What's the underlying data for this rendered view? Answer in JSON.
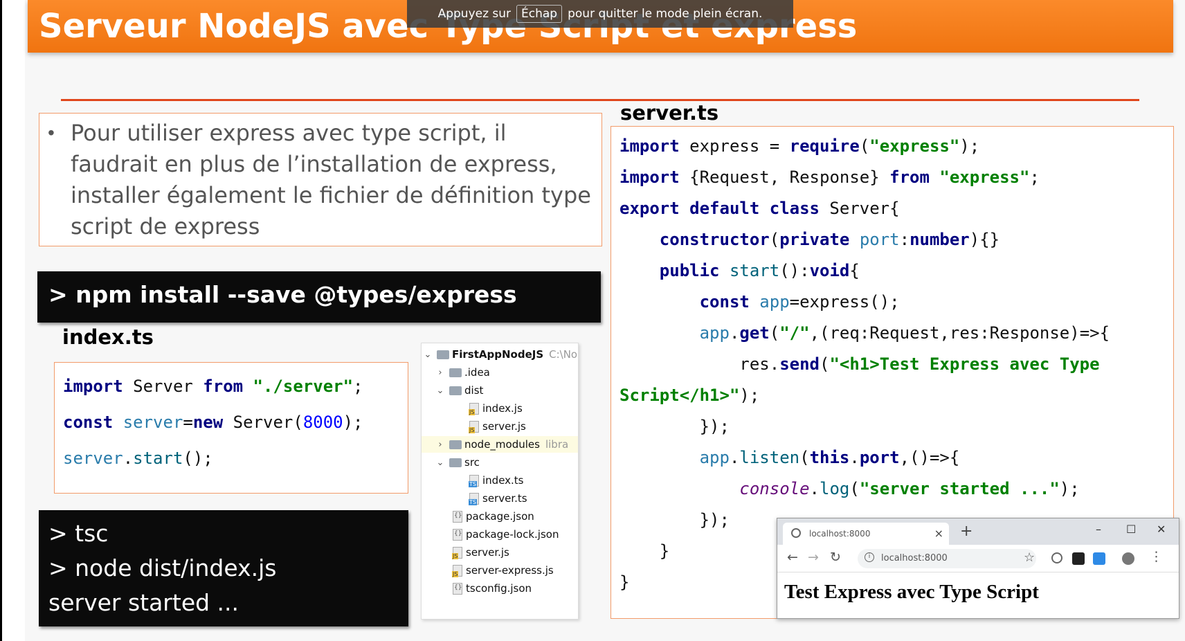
{
  "slide": {
    "title": "Serveur NodeJS avec Type Script et express",
    "bullet": "Pour utiliser express avec type script, il faudrait en plus de l’installation de express, installer également le fichier de définition type script de express"
  },
  "fullscreen_notice": {
    "before": "Appuyez sur",
    "key": "Échap",
    "after": "pour quitter le mode plein écran."
  },
  "terminal_npm": "> npm install --save @types/express",
  "index_label": "index.ts",
  "server_label": "server.ts",
  "terminal_tsc": [
    "> tsc",
    "> node dist/index.js",
    "server started ..."
  ],
  "index_code": [
    "import Server from \"./server\";",
    "const server=new Server(8000);",
    "server.start();"
  ],
  "server_code": [
    "import express = require(\"express\");",
    "import {Request, Response} from \"express\";",
    "export default class Server{",
    "    constructor(private port:number){}",
    "    public start():void{",
    "        const app=express();",
    "        app.get(\"/\",(req:Request,res:Response)=>{",
    "            res.send(\"<h1>Test Express avec Type",
    "Script</h1>\");",
    "        });",
    "        app.listen(this.port,()=>{",
    "            console.log(\"server started ...\");",
    "        });",
    "    }",
    "}"
  ],
  "project_tree": {
    "root": "FirstAppNodeJS",
    "root_path": "C:\\No",
    "items": [
      {
        "name": ".idea",
        "type": "folder",
        "depth": 1,
        "state": "collapsed"
      },
      {
        "name": "dist",
        "type": "folder",
        "depth": 1,
        "state": "expanded"
      },
      {
        "name": "index.js",
        "type": "js",
        "depth": 2
      },
      {
        "name": "server.js",
        "type": "js",
        "depth": 2
      },
      {
        "name": "node_modules",
        "type": "folder",
        "depth": 1,
        "state": "collapsed",
        "note": "libra"
      },
      {
        "name": "src",
        "type": "folder",
        "depth": 1,
        "state": "expanded"
      },
      {
        "name": "index.ts",
        "type": "ts",
        "depth": 2
      },
      {
        "name": "server.ts",
        "type": "ts",
        "depth": 2
      },
      {
        "name": "package.json",
        "type": "json",
        "depth": 1
      },
      {
        "name": "package-lock.json",
        "type": "json",
        "depth": 1
      },
      {
        "name": "server.js",
        "type": "js",
        "depth": 1
      },
      {
        "name": "server-express.js",
        "type": "js",
        "depth": 1
      },
      {
        "name": "tsconfig.json",
        "type": "json",
        "depth": 1
      }
    ]
  },
  "browser": {
    "tab_title": "localhost:8000",
    "url": "localhost:8000",
    "page_heading": "Test Express avec Type Script",
    "icons": [
      "globe-icon",
      "close-icon",
      "plus-icon",
      "minimize-icon",
      "maximize-icon",
      "back-icon",
      "forward-icon",
      "reload-icon",
      "info-icon",
      "star-icon",
      "menu-icon"
    ]
  },
  "colors": {
    "title_bar": "#f57c1b",
    "accent_line": "#e0471c",
    "keyword": "#000080",
    "string": "#008000",
    "number": "#0000ff"
  }
}
